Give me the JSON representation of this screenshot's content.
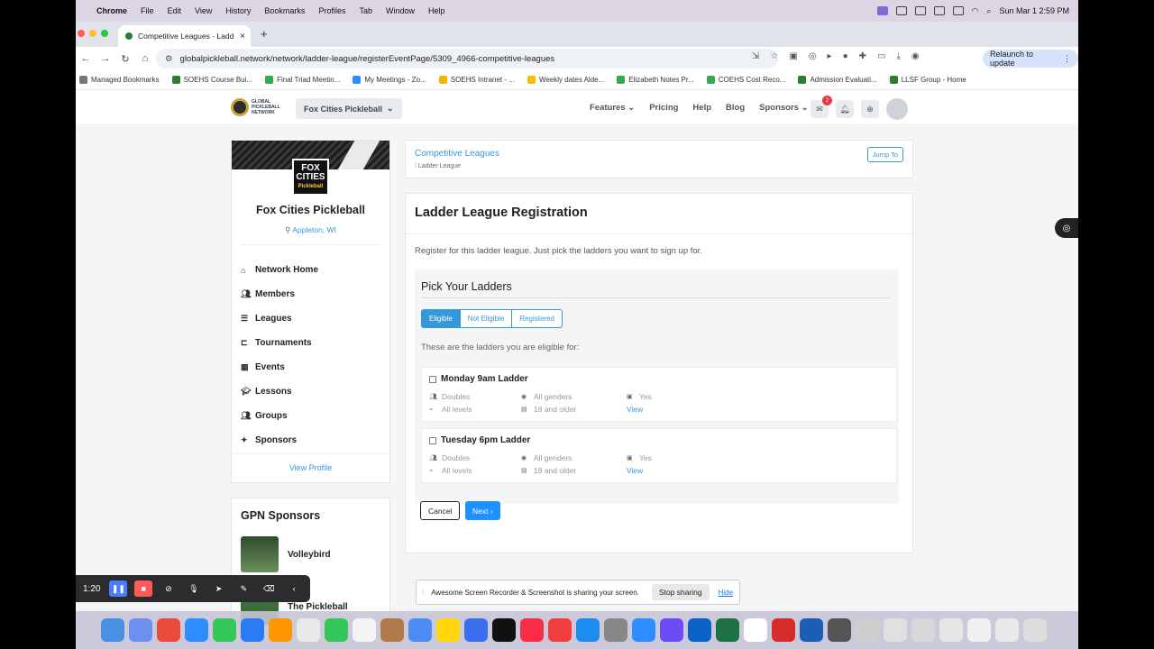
{
  "menubar": {
    "app": "Chrome",
    "items": [
      "File",
      "Edit",
      "View",
      "History",
      "Bookmarks",
      "Profiles",
      "Tab",
      "Window",
      "Help"
    ],
    "clock": "Sun Mar 1  2:59 PM"
  },
  "browser": {
    "tab_title": "Competitive Leagues - Ladd",
    "url": "globalpickleball.network/network/ladder-league/registerEventPage/5309_4966-competitive-leagues",
    "relaunch": "Relaunch to update",
    "bookmarks": [
      {
        "label": "Managed Bookmarks",
        "color": "#777777"
      },
      {
        "label": "SOEHS Course Bui...",
        "color": "#2e7d32"
      },
      {
        "label": "Final Triad Meetin...",
        "color": "#34a853"
      },
      {
        "label": "My Meetings - Zo...",
        "color": "#2d8cff"
      },
      {
        "label": "SOEHS Intranet - ...",
        "color": "#f4b400"
      },
      {
        "label": "Weekly dates Alde...",
        "color": "#fbbc04"
      },
      {
        "label": "Elizabeth Notes Pr...",
        "color": "#34a853"
      },
      {
        "label": "COEHS Cost Reco...",
        "color": "#34a853"
      },
      {
        "label": "Admission Evaluati...",
        "color": "#2e7d32"
      },
      {
        "label": "LLSF Group - Home",
        "color": "#2e7d32"
      }
    ]
  },
  "site": {
    "logo_text": "GLOBAL PICKLEBALL NETWORK",
    "network_select": "Fox Cities Pickleball",
    "nav": [
      "Features",
      "Pricing",
      "Help",
      "Blog",
      "Sponsors"
    ],
    "message_count": "2"
  },
  "profile": {
    "logo_lines": [
      "FOX",
      "CITIES",
      "Pickleball"
    ],
    "name": "Fox Cities Pickleball",
    "location": "Appleton, WI",
    "menu": [
      {
        "label": "Network Home",
        "icon": "home-icon"
      },
      {
        "label": "Members",
        "icon": "users-icon"
      },
      {
        "label": "Leagues",
        "icon": "list-icon"
      },
      {
        "label": "Tournaments",
        "icon": "bracket-icon"
      },
      {
        "label": "Events",
        "icon": "calendar-icon"
      },
      {
        "label": "Lessons",
        "icon": "graduation-cap-icon"
      },
      {
        "label": "Groups",
        "icon": "group-icon"
      },
      {
        "label": "Sponsors",
        "icon": "sparkle-icon"
      }
    ],
    "view_profile": "View Profile"
  },
  "sponsors": {
    "title": "GPN Sponsors",
    "items": [
      "Volleybird",
      "The Pickleball"
    ]
  },
  "breadcrumb": {
    "title": "Competitive Leagues",
    "sub": "Ladder League",
    "jump": "Jump To"
  },
  "registration": {
    "title": "Ladder League Registration",
    "description": "Register for this ladder league. Just pick the ladders you want to sign up for.",
    "pick_title": "Pick Your Ladders",
    "filters": [
      "Eligible",
      "Not Eligible",
      "Registered"
    ],
    "eligible_note": "These are the ladders you are eligible for:",
    "ladders": [
      {
        "name": "Monday 9am Ladder",
        "format": "Doubles",
        "gender": "All genders",
        "yes": "Yes",
        "level": "All levels",
        "age": "18 and older",
        "view": "View"
      },
      {
        "name": "Tuesday 6pm Ladder",
        "format": "Doubles",
        "gender": "All genders",
        "yes": "Yes",
        "level": "All levels",
        "age": "18 and older",
        "view": "View"
      }
    ],
    "cancel": "Cancel",
    "next": "Next ›"
  },
  "recorder": {
    "time": "1:20"
  },
  "share_bar": {
    "message": "Awesome Screen Recorder & Screenshot is sharing your screen.",
    "stop": "Stop sharing",
    "hide": "Hide"
  }
}
